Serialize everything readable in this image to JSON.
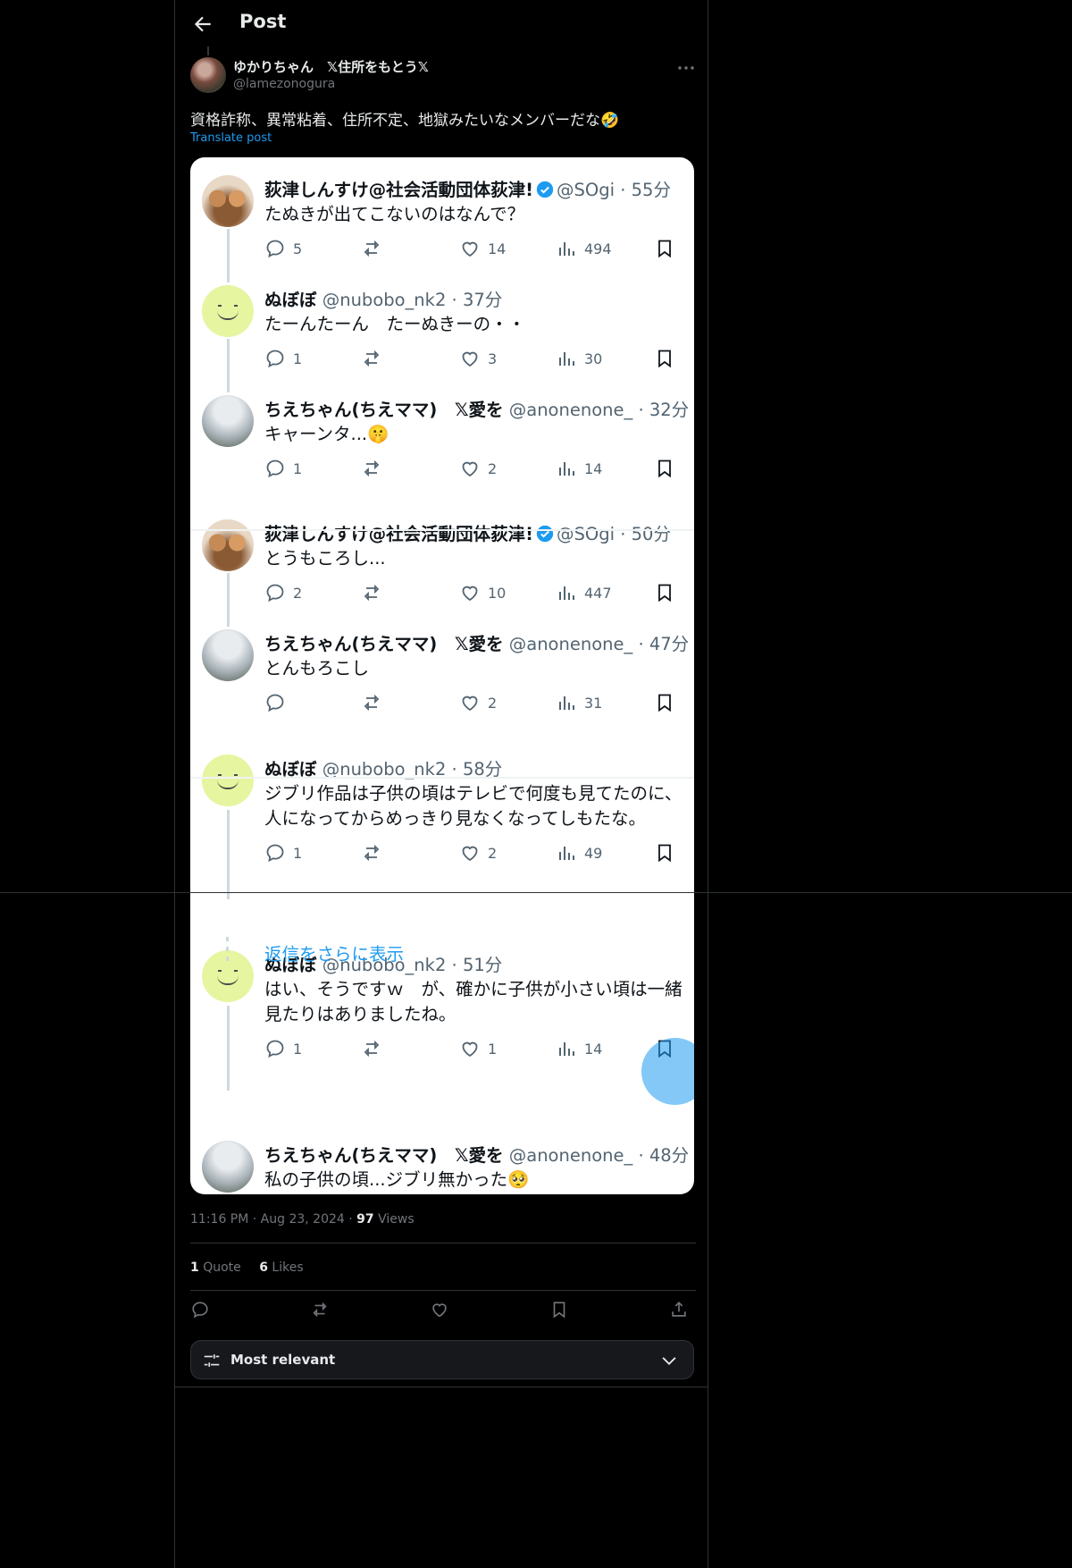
{
  "header": {
    "title": "Post"
  },
  "author": {
    "name": "ゆかりちゃん　𝕏住所をもとう𝕏",
    "handle": "@lamezonogura"
  },
  "post": {
    "text": "資格詐称、異常粘着、住所不定、地獄みたいなメンバーだな🤣",
    "translate": "Translate post"
  },
  "embedded": {
    "tweets": [
      {
        "name": "荻津しんすけ@社会活動団体荻津!",
        "meta": "@SOgi · 55分",
        "verified": true,
        "avatar": "dogs",
        "text": [
          "たぬきが出てこないのはなんで？"
        ],
        "replies": "5",
        "likes": "14",
        "views": "494"
      },
      {
        "name": "ぬぼぼ",
        "meta": "@nubobo_nk2 · 37分",
        "verified": false,
        "avatar": "smile",
        "text": [
          "たーんたーん　たーぬきーの・・"
        ],
        "replies": "1",
        "likes": "3",
        "views": "30"
      },
      {
        "name": "ちえちゃん(ちえママ)　𝕏愛を",
        "meta": "@anonenone_ · 32分",
        "verified": false,
        "avatar": "mist",
        "text": [
          "キャーンタ...🤫"
        ],
        "replies": "1",
        "likes": "2",
        "views": "14"
      },
      {
        "name": "荻津しんすけ@社会活動団体荻津!",
        "meta": "@SOgi · 50分",
        "verified": true,
        "avatar": "dogs",
        "text": [
          "とうもころし..."
        ],
        "replies": "2",
        "likes": "10",
        "views": "447"
      },
      {
        "name": "ちえちゃん(ちえママ)　𝕏愛を",
        "meta": "@anonenone_ · 47分",
        "verified": false,
        "avatar": "mist",
        "text": [
          "とんもろこし"
        ],
        "replies": "",
        "likes": "2",
        "views": "31"
      },
      {
        "name": "ぬぼぼ",
        "meta": "@nubobo_nk2 · 58分",
        "verified": false,
        "avatar": "smile",
        "text": [
          "ジブリ作品は子供の頃はテレビで何度も見てたのに、",
          "人になってからめっきり見なくなってしもたな。"
        ],
        "replies": "1",
        "likes": "2",
        "views": "49"
      },
      {
        "name": "ぬぼぼ",
        "meta": "@nubobo_nk2 · 51分",
        "verified": false,
        "avatar": "smile",
        "text": [
          "はい、そうですｗ　が、確かに子供が小さい頃は一緒",
          "見たりはありましたね。"
        ],
        "replies": "1",
        "likes": "1",
        "views": "14"
      },
      {
        "name": "ちえちゃん(ちえママ)　𝕏愛を",
        "meta": "@anonenone_ · 48分",
        "verified": false,
        "avatar": "mist",
        "text": [
          "私の子供の頃...ジブリ無かった🥺"
        ]
      }
    ],
    "show_more": "返信をさらに表示"
  },
  "meta": {
    "time": "11:16 PM · Aug 23, 2024 · ",
    "views_count": "97",
    "views_label": " Views"
  },
  "stats": {
    "quotes_count": "1",
    "quotes_label": " Quote",
    "likes_count": "6",
    "likes_label": " Likes"
  },
  "sort": {
    "label": "Most relevant"
  },
  "colors": {
    "accent": "#1d9bf0",
    "background": "#000000",
    "border": "#2f3336",
    "muted": "#71767b"
  },
  "icons": [
    "back-arrow-icon",
    "more-icon",
    "reply-icon",
    "repost-icon",
    "like-icon",
    "views-icon",
    "bookmark-icon",
    "share-icon",
    "filter-icon",
    "chevron-down-icon",
    "verified-icon"
  ]
}
